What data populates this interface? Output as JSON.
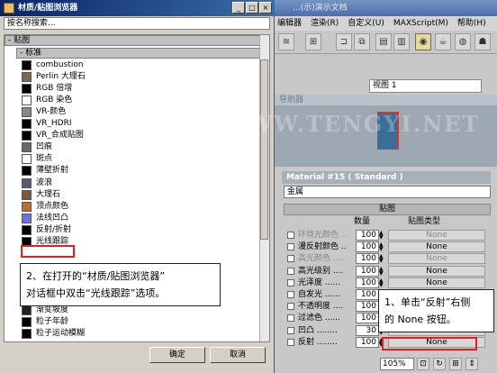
{
  "max_window": {
    "title": "...(示)演示文档",
    "menu": [
      "编辑器",
      "渲染(R)",
      "自定义(U)",
      "MAXScript(M)",
      "帮助(H)"
    ],
    "viewport_select": "视图 1",
    "viewport_title": "导航器",
    "material_header": "Material #15 ( Standard )",
    "material_name": "金属",
    "maps_rollout": "贴图",
    "maps_header": {
      "amount": "数量",
      "type": "贴图类型"
    },
    "map_rows": [
      {
        "name": "环境光颜色 ..",
        "amount": "100",
        "map": "None",
        "disabled": true
      },
      {
        "name": "漫反射颜色 ..",
        "amount": "100",
        "map": "None",
        "disabled": false
      },
      {
        "name": "高光颜色 ....",
        "amount": "100",
        "map": "None",
        "disabled": true
      },
      {
        "name": "高光级别 ....",
        "amount": "100",
        "map": "None",
        "disabled": false
      },
      {
        "name": "光泽度 ......",
        "amount": "100",
        "map": "None",
        "disabled": false
      },
      {
        "name": "自发光 ......",
        "amount": "100",
        "map": "None",
        "disabled": false
      },
      {
        "name": "不透明度 ....",
        "amount": "100",
        "map": "None",
        "disabled": false
      },
      {
        "name": "过滤色 ......",
        "amount": "100",
        "map": "None",
        "disabled": false
      },
      {
        "name": "凹凸 ........",
        "amount": "30",
        "map": "None",
        "disabled": false
      },
      {
        "name": "反射 ........",
        "amount": "100",
        "map": "None",
        "disabled": false
      }
    ],
    "zoom": "105%"
  },
  "browser": {
    "title": "材质/贴图浏览器",
    "search_placeholder": "按名称搜索...",
    "rollout_maps": "- 贴图",
    "rollout_standard": "- 标准",
    "items": [
      {
        "label": "combustion",
        "color": "#000000"
      },
      {
        "label": "Perlin 大理石",
        "color": "#7a6a4a"
      },
      {
        "label": "RGB 倍增",
        "color": "#000000"
      },
      {
        "label": "RGB 染色",
        "color": "#ffffff"
      },
      {
        "label": "VR-颜色",
        "color": "#888888"
      },
      {
        "label": "VR_HDRI",
        "color": "#000000"
      },
      {
        "label": "VR_合成贴图",
        "color": "#000000"
      },
      {
        "label": "凹痕",
        "color": "#6a6a6a"
      },
      {
        "label": "斑点",
        "color": "#ffffff"
      },
      {
        "label": "薄壁折射",
        "color": "#000000"
      },
      {
        "label": "波浪",
        "color": "#5a5a6a"
      },
      {
        "label": "大理石",
        "color": "#7a5a3a"
      },
      {
        "label": "顶点颜色",
        "color": "#c07020"
      },
      {
        "label": "法线凹凸",
        "color": "#7070e0"
      },
      {
        "label": "反射/折射",
        "color": "#000000"
      },
      {
        "label": "光线跟踪",
        "color": "#000000"
      },
      {
        "label": "渐变坡度",
        "color": "#222222"
      },
      {
        "label": "粒子年龄",
        "color": "#000000"
      },
      {
        "label": "粒子运动模糊",
        "color": "#000000"
      }
    ],
    "ok_label": "确定",
    "cancel_label": "取消"
  },
  "callouts": {
    "step2_line1": "2、在打开的“材质/贴图浏览器”",
    "step2_line2": "对话框中双击“光线跟踪”选项。",
    "step1_line1": "1、单击“反射”右侧",
    "step1_line2": "的 None 按钮。"
  },
  "watermark": "腾龍視覺 WWW.TENGYI.NET"
}
